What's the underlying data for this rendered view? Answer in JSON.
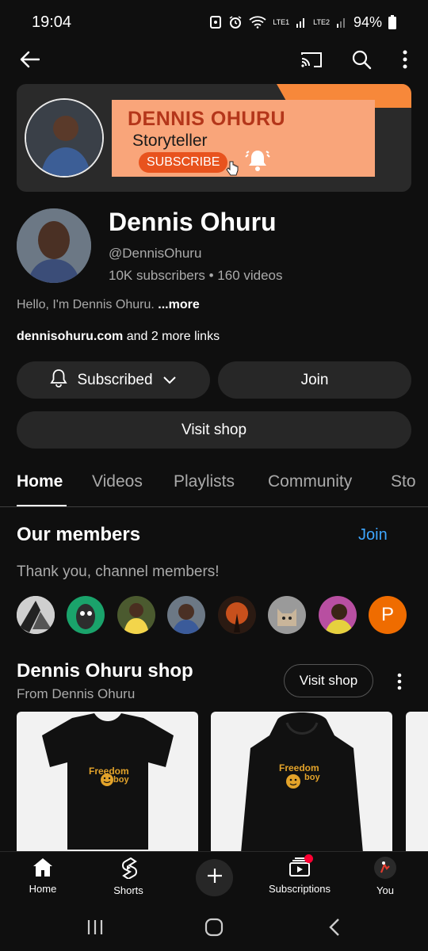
{
  "status_bar": {
    "time": "19:04",
    "battery": "94%",
    "sim1": "LTE1",
    "sim2": "LTE2"
  },
  "app_bar": {
    "icons": [
      "back-arrow-icon",
      "cast-icon",
      "search-icon",
      "more-vert-icon"
    ]
  },
  "banner": {
    "title": "DENNIS OHURU",
    "subtitle": "Storyteller",
    "button": "SUBSCRIBE",
    "accent_color": "#f7883a"
  },
  "channel": {
    "name": "Dennis Ohuru",
    "handle": "@DennisOhuru",
    "stats": "10K subscribers • 160 videos",
    "description": "Hello, I'm Dennis Ohuru.",
    "description_more": "...more",
    "link_site": "dennisohuru.com",
    "link_more": "and 2 more links"
  },
  "actions": {
    "subscribed": "Subscribed",
    "join": "Join",
    "visit_shop": "Visit shop"
  },
  "tabs": [
    {
      "label": "Home",
      "active": true
    },
    {
      "label": "Videos",
      "active": false
    },
    {
      "label": "Playlists",
      "active": false
    },
    {
      "label": "Community",
      "active": false
    },
    {
      "label": "Sto",
      "active": false
    }
  ],
  "members": {
    "title": "Our members",
    "join": "Join",
    "thanks": "Thank you, channel members!",
    "letter_avatar": "P",
    "letter_avatar_color": "#ef6c00"
  },
  "shop": {
    "title": "Dennis Ohuru shop",
    "from": "From Dennis Ohuru",
    "visit_button": "Visit shop",
    "product_print_top": "Freedom",
    "product_print_bottom": "boy"
  },
  "bottom_nav": {
    "home": "Home",
    "shorts": "Shorts",
    "subscriptions": "Subscriptions",
    "you": "You"
  }
}
